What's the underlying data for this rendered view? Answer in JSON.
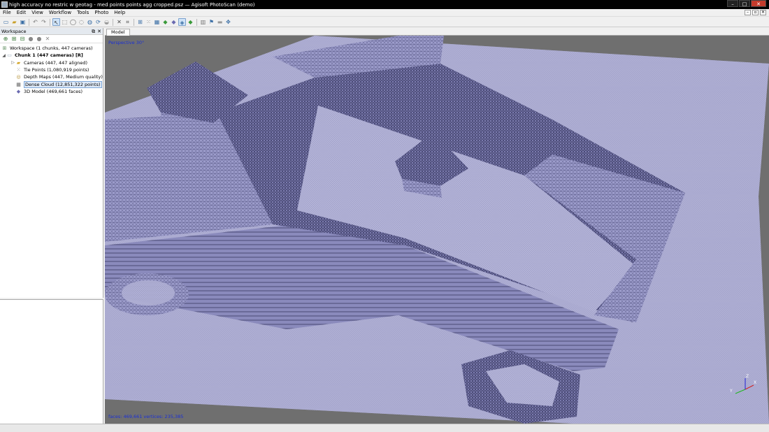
{
  "window": {
    "title": "high accuracy no restric w geotag - med points points agg cropped.psz — Agisoft PhotoScan (demo)",
    "minimize": "–",
    "maximize": "□",
    "close": "✕"
  },
  "menu": {
    "items": [
      "File",
      "Edit",
      "View",
      "Workflow",
      "Tools",
      "Photo",
      "Help"
    ],
    "mdi_min": "–",
    "mdi_restore": "▫",
    "mdi_close": "✕"
  },
  "workspace": {
    "title": "Workspace",
    "dock_glyph": "⧉",
    "close_glyph": "✕",
    "tree": {
      "root": "Workspace (1 chunks, 447 cameras)",
      "chunk": "Chunk 1 (447 cameras) [R]",
      "cameras": "Cameras (447, 447 aligned)",
      "tie_points": "Tie Points (1,080,919 points)",
      "depth_maps": "Depth Maps (447, Medium quality)",
      "dense_cloud": "Dense Cloud (12,851,322 points)",
      "model": "3D Model (469,661 faces)"
    }
  },
  "tabs": {
    "model": "Model"
  },
  "viewport": {
    "perspective": "Perspective 30°",
    "stats": "faces: 469,661 vertices: 235,385",
    "axis_x": "X",
    "axis_y": "Y",
    "axis_z": "Z"
  },
  "colors": {
    "mesh_fill": "#9c9ccb",
    "mesh_dark": "#4a4a78",
    "background": "#6f6f6f"
  }
}
